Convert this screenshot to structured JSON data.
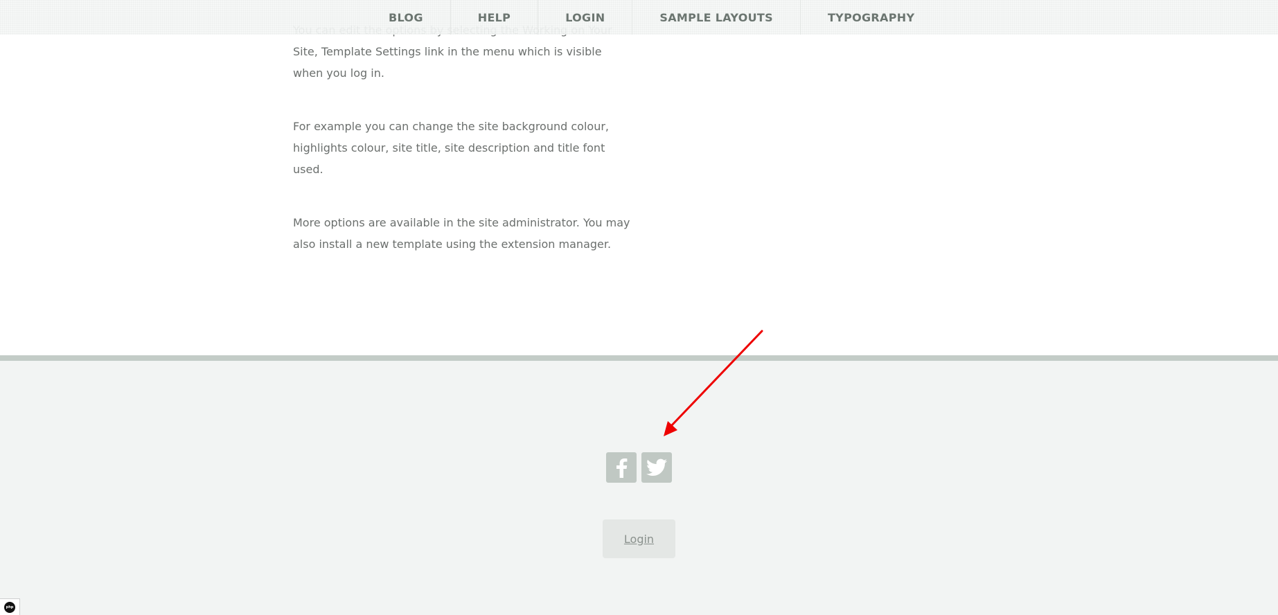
{
  "nav": {
    "items": [
      {
        "label": "BLOG"
      },
      {
        "label": "HELP"
      },
      {
        "label": "LOGIN"
      },
      {
        "label": "SAMPLE LAYOUTS"
      },
      {
        "label": "TYPOGRAPHY"
      }
    ]
  },
  "content": {
    "paragraphs": [
      "You can edit the options by selecting the Working on Your Site, Template Settings link in the menu which is visible when you log in.",
      "For example you can change the site background colour, highlights colour, site title, site description and title font used.",
      "More options are available in the site administrator. You may also install a new template using the extension manager."
    ]
  },
  "footer": {
    "social": [
      {
        "icon": "facebook-icon"
      },
      {
        "icon": "twitter-icon"
      }
    ],
    "login_label": "Login"
  },
  "badge": {
    "label": "php"
  },
  "colors": {
    "nav_text": "#6b7570",
    "body_text": "#6b6f6d",
    "footer_bg": "#f2f4f3",
    "footer_border": "#c3ccc7",
    "social_bg": "#c0c8c3",
    "annotation": "#ee0000"
  }
}
